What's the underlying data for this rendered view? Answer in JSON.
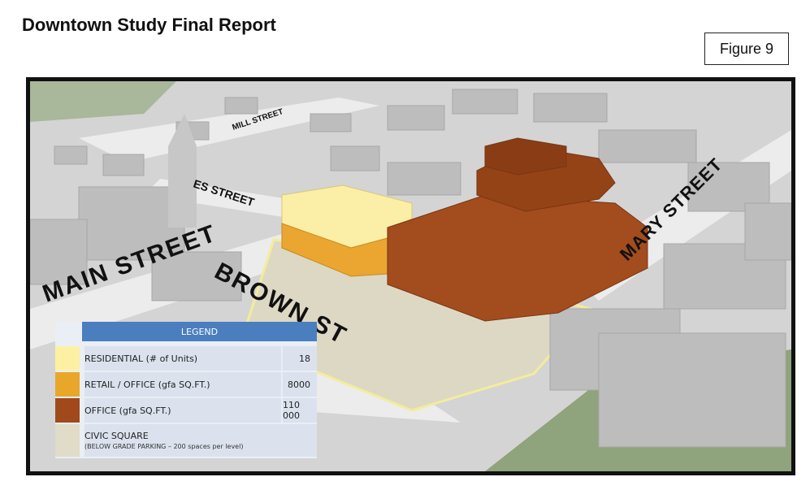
{
  "header": {
    "title": "Downtown Study Final Report"
  },
  "figure_label": "Figure 9",
  "map": {
    "streets": {
      "mill": "MILL STREET",
      "james": "ES STREET",
      "main": "MAIN STREET",
      "brown": "BROWN ST",
      "mary": "MARY STREET"
    }
  },
  "legend": {
    "title": "LEGEND",
    "items": [
      {
        "label": "RESIDENTIAL (# of Units)",
        "value": "18",
        "color": "#fdf0a3"
      },
      {
        "label": "RETAIL / OFFICE (gfa SQ.FT.)",
        "value": "8000",
        "color": "#e9a72a"
      },
      {
        "label": "OFFICE (gfa SQ.FT.)",
        "value": "110 000",
        "color": "#a04a1c"
      },
      {
        "label": "CIVIC SQUARE",
        "sublabel": "(BELOW GRADE PARKING – 200 spaces per level)",
        "value": "",
        "color": "#e0dcc8"
      }
    ]
  }
}
